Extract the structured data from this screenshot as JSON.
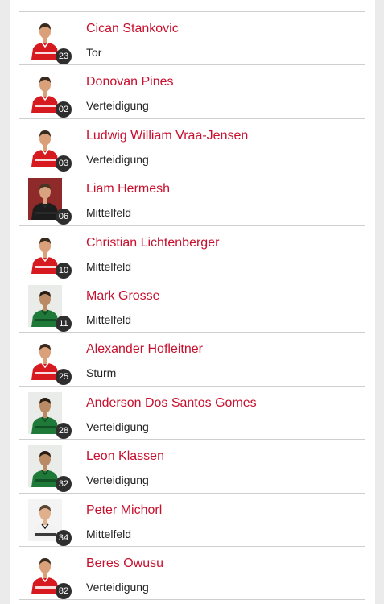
{
  "colors": {
    "accent": "#c8102e",
    "badge": "#2e2e2e",
    "divider": "#cfcfcf",
    "side_background": "#ebebeb"
  },
  "players": [
    {
      "number": "23",
      "name": "Cican Stankovic",
      "position": "Tor",
      "photo_icon": "player-photo-red-kit"
    },
    {
      "number": "02",
      "name": "Donovan Pines",
      "position": "Verteidigung",
      "photo_icon": "player-photo-red-kit"
    },
    {
      "number": "03",
      "name": "Ludwig William Vraa-Jensen",
      "position": "Verteidigung",
      "photo_icon": "player-photo-red-kit"
    },
    {
      "number": "06",
      "name": "Liam Hermesh",
      "position": "Mittelfeld",
      "photo_icon": "player-photo-dark-background"
    },
    {
      "number": "10",
      "name": "Christian Lichtenberger",
      "position": "Mittelfeld",
      "photo_icon": "player-photo-red-kit"
    },
    {
      "number": "11",
      "name": "Mark Grosse",
      "position": "Mittelfeld",
      "photo_icon": "player-photo-green-kit"
    },
    {
      "number": "25",
      "name": "Alexander Hofleitner",
      "position": "Sturm",
      "photo_icon": "player-photo-red-kit"
    },
    {
      "number": "28",
      "name": "Anderson Dos Santos Gomes",
      "position": "Verteidigung",
      "photo_icon": "player-photo-green-kit"
    },
    {
      "number": "32",
      "name": "Leon Klassen",
      "position": "Verteidigung",
      "photo_icon": "player-photo-green-kit"
    },
    {
      "number": "34",
      "name": "Peter Michorl",
      "position": "Mittelfeld",
      "photo_icon": "player-photo-black-white-kit"
    },
    {
      "number": "82",
      "name": "Beres Owusu",
      "position": "Verteidigung",
      "photo_icon": "player-photo-red-kit"
    }
  ]
}
